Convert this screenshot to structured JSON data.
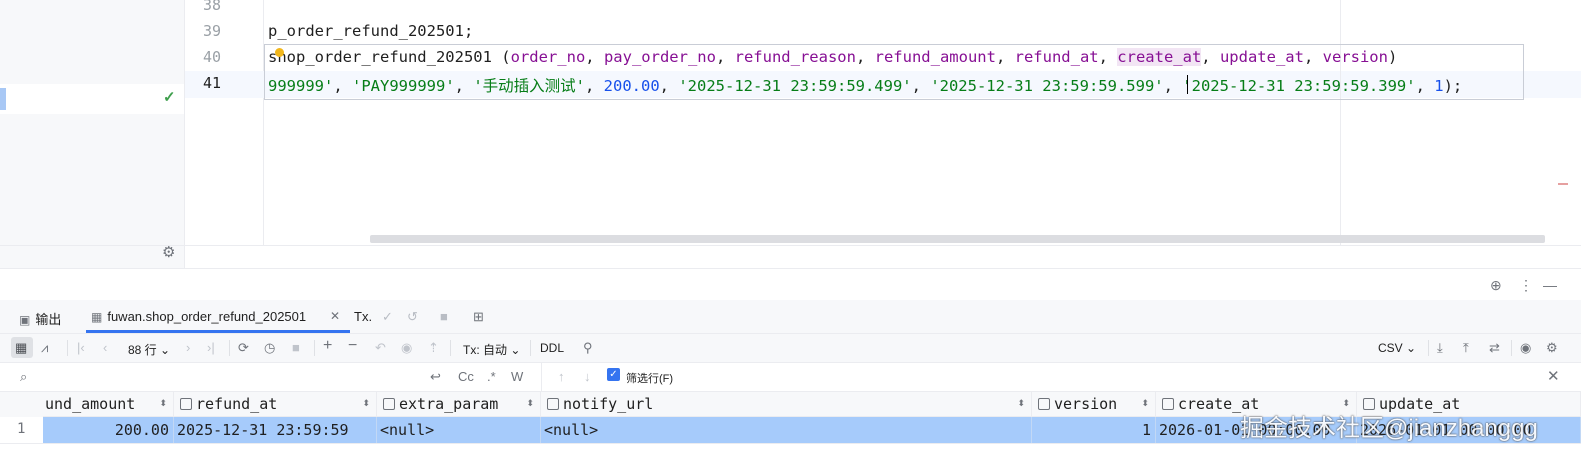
{
  "editor": {
    "line_numbers": [
      "38",
      "39",
      "40",
      "41"
    ],
    "line39_text": "p_order_refund_202501;",
    "line40": {
      "prefix": "shop_order_refund_202501 (",
      "cols": [
        "order_no",
        "pay_order_no",
        "refund_reason",
        "refund_amount",
        "refund_at",
        "create_at",
        "update_at",
        "version"
      ],
      "sep": ", ",
      "suffix": ")"
    },
    "line41": {
      "v1": "999999'",
      "c1": ", ",
      "v2": "'PAY999999'",
      "c2": ", ",
      "v3": "'手动插入测试'",
      "c3": ", ",
      "v4": "200.00",
      "c4": ", ",
      "v5": "'2025-12-31 23:59:59.499'",
      "c5": ", ",
      "v6": "'2025-12-31 23:59:59.599'",
      "c6": ", ",
      "v7": "'2025-12-31 23:59:59.399'",
      "c7": ", ",
      "v8": "1",
      "end": ");"
    }
  },
  "tabs": {
    "output": "输出",
    "table_tab": "fuwan.shop_order_refund_202501",
    "tx": "Tx."
  },
  "toolbar": {
    "row_count": "88 行",
    "tx_mode": "Tx: 自动",
    "ddl": "DDL",
    "export_format": "CSV"
  },
  "filterbar": {
    "cc": "Cc",
    "regex": ".*",
    "word": "W",
    "filter_rows_label": "筛选行(F)",
    "filter_rows_checked": true
  },
  "table": {
    "columns": [
      {
        "name": "und_amount",
        "has_icon": false
      },
      {
        "name": "refund_at",
        "has_icon": true
      },
      {
        "name": "extra_param",
        "has_icon": true
      },
      {
        "name": "notify_url",
        "has_icon": true
      },
      {
        "name": "version",
        "has_icon": true
      },
      {
        "name": "create_at",
        "has_icon": true
      },
      {
        "name": "update_at",
        "has_icon": true
      }
    ],
    "row_number": "1",
    "row": [
      "200.00",
      "2025-12-31 23:59:59",
      "<null>",
      "<null>",
      "1",
      "2026-01-01 00:00:00",
      "2026-01-01 00:00:00"
    ]
  },
  "watermark": "掘金技术社区@jianzhanggg"
}
